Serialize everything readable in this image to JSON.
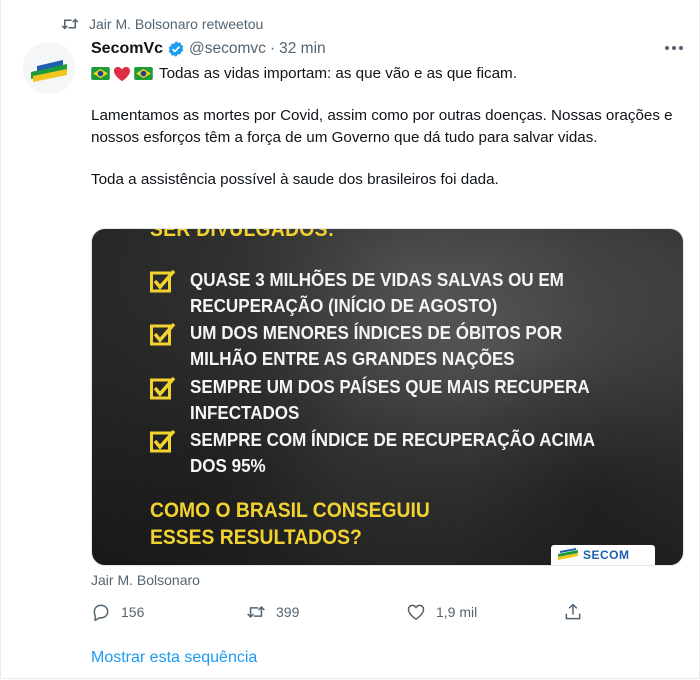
{
  "retweet": {
    "label": "Jair M. Bolsonaro retweetou"
  },
  "author": {
    "display_name": "SecomVc",
    "handle": "@secomvc",
    "separator": "·",
    "time": "32 min"
  },
  "tweet": {
    "line1_text": "Todas as vidas importam: as que vão e as que ficam.",
    "para2": "Lamentamos as mortes por Covid, assim como por outras doenças. Nossas orações e nossos esforços têm a força de um Governo que dá tudo para salvar vidas.",
    "para3": "Toda a assistência possível à saude dos brasileiros foi dada."
  },
  "media": {
    "top_text": "SER DIVULGADOS:",
    "items": [
      {
        "line1": "QUASE 3 MILHÕES DE VIDAS SALVAS OU EM",
        "line2": "RECUPERAÇÃO (INÍCIO DE AGOSTO)"
      },
      {
        "line1": "UM DOS MENORES ÍNDICES DE ÓBITOS POR",
        "line2": "MILHÃO ENTRE AS GRANDES NAÇÕES"
      },
      {
        "line1": "SEMPRE UM DOS PAÍSES QUE MAIS RECUPERA",
        "line2": "INFECTADOS"
      },
      {
        "line1": "SEMPRE COM ÍNDICE DE RECUPERAÇÃO ACIMA",
        "line2": "DOS 95%"
      }
    ],
    "question_line1": "COMO O BRASIL CONSEGUIU",
    "question_line2": "ESSES RESULTADOS?",
    "badge_text": "SECOM"
  },
  "footer": {
    "author_label": "Jair M. Bolsonaro",
    "replies": "156",
    "retweets": "399",
    "likes": "1,9 mil",
    "show_thread": "Mostrar esta sequência"
  },
  "colors": {
    "accent": "#1d9bf0",
    "secondary_text": "#536471",
    "media_yellow": "#f2d230"
  },
  "icons": {
    "retweet": "retweet-icon",
    "verified": "verified-badge-icon",
    "more": "more-options-icon",
    "reply": "reply-icon",
    "like": "heart-icon",
    "share": "share-icon",
    "flag": "brazil-flag-icon",
    "heart_emoji": "red-heart-icon"
  }
}
